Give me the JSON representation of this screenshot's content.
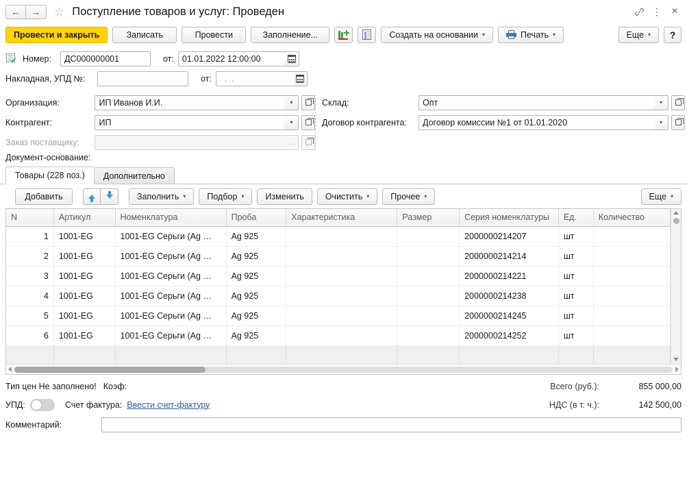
{
  "titlebar": {
    "back_label": "←",
    "forward_label": "→",
    "star_label": "☆",
    "title": "Поступление товаров и услуг: Проведен",
    "link_icon": "🔗",
    "menu_icon": "⋮",
    "close_icon": "×"
  },
  "commandbar": {
    "post_and_close": "Провести и закрыть",
    "write": "Записать",
    "post": "Провести",
    "fill": "Заполнение...",
    "create_on_basis": "Создать на основании",
    "print": "Печать",
    "more": "Еще",
    "help": "?",
    "caret": "▾"
  },
  "form": {
    "number_label": "Номер:",
    "number_value": "ДС000000001",
    "date_from_label": "от:",
    "date_value": "01.01.2022 12:00:00",
    "invoice_label": "Накладная, УПД №:",
    "invoice_value": "",
    "invoice_date_label": "от:",
    "invoice_date_value": "",
    "invoice_date_placeholder": "  .  .",
    "org_label": "Организация:",
    "org_value": "ИП Иванов И.И.",
    "counterparty_label": "Контрагент:",
    "counterparty_value": "ИП",
    "order_label": "Заказ поставщику:",
    "order_value": "",
    "warehouse_label": "Склад:",
    "warehouse_value": "Опт",
    "contract_label": "Договор  контрагента:",
    "contract_value": "Договор комиссии №1 от 01.01.2020",
    "basis_doc_label": "Документ-основание:",
    "ellipsis": "...",
    "caret": "▾"
  },
  "tabs": [
    {
      "label": "Товары (228 поз.)",
      "active": true
    },
    {
      "label": "Дополнительно",
      "active": false
    }
  ],
  "table_toolbar": {
    "add": "Добавить",
    "move_up_icon": "arrow-up-icon",
    "move_down_icon": "arrow-down-icon",
    "fill": "Заполнить",
    "select": "Подбор",
    "change": "Изменить",
    "clear": "Очистить",
    "other": "Прочее",
    "more": "Еще",
    "caret": "▾"
  },
  "grid": {
    "columns": [
      "N",
      "Артикул",
      "Номенклатура",
      "Проба",
      "Характеристика",
      "Размер",
      "Серия номенклатуры",
      "Ед.",
      "Количество"
    ],
    "rows": [
      {
        "n": "1",
        "article": "1001-EG",
        "nomenclature": "1001-EG Серьги (Ag …",
        "proba": "Ag 925",
        "characteristic": "",
        "size": "",
        "series": "2000000214207",
        "unit": "шт",
        "qty": ""
      },
      {
        "n": "2",
        "article": "1001-EG",
        "nomenclature": "1001-EG Серьги (Ag …",
        "proba": "Ag 925",
        "characteristic": "",
        "size": "",
        "series": "2000000214214",
        "unit": "шт",
        "qty": ""
      },
      {
        "n": "3",
        "article": "1001-EG",
        "nomenclature": "1001-EG Серьги (Ag …",
        "proba": "Ag 925",
        "characteristic": "",
        "size": "",
        "series": "2000000214221",
        "unit": "шт",
        "qty": ""
      },
      {
        "n": "4",
        "article": "1001-EG",
        "nomenclature": "1001-EG Серьги (Ag …",
        "proba": "Ag 925",
        "characteristic": "",
        "size": "",
        "series": "2000000214238",
        "unit": "шт",
        "qty": ""
      },
      {
        "n": "5",
        "article": "1001-EG",
        "nomenclature": "1001-EG Серьги (Ag …",
        "proba": "Ag 925",
        "characteristic": "",
        "size": "",
        "series": "2000000214245",
        "unit": "шт",
        "qty": ""
      },
      {
        "n": "6",
        "article": "1001-EG",
        "nomenclature": "1001-EG Серьги (Ag …",
        "proba": "Ag 925",
        "characteristic": "",
        "size": "",
        "series": "2000000214252",
        "unit": "шт",
        "qty": ""
      }
    ]
  },
  "footer": {
    "price_type_label": "Тип цен Не заполнено!",
    "coef_label": "Коэф:",
    "upd_label": "УПД:",
    "invoice_label": "Счет фактура:",
    "invoice_link": "Ввести счет-фактуру",
    "comment_label": "Комментарий:",
    "comment_value": "",
    "total_label": "Всего (руб.):",
    "total_value": "855 000,00",
    "vat_label": "НДС (в т. ч.):",
    "vat_value": "142 500,00"
  },
  "colors": {
    "primary_button": "#ffd400",
    "link": "#2a5db0",
    "header_text": "#5c5c5c"
  }
}
